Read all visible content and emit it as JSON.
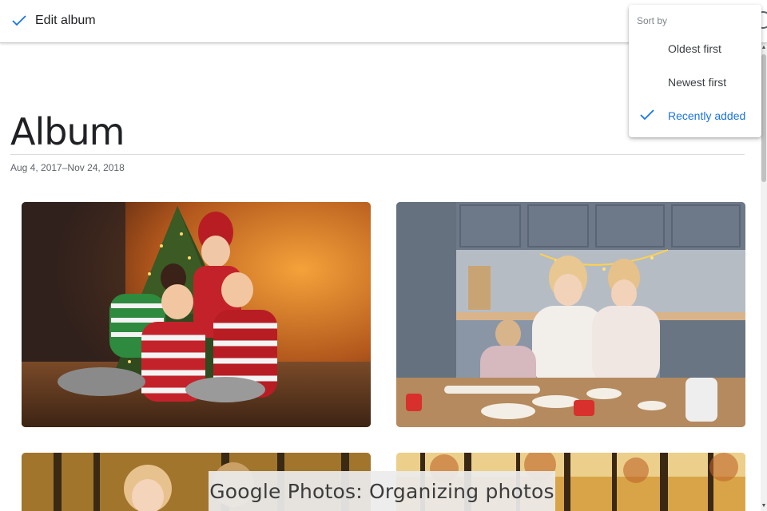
{
  "topbar": {
    "done_icon": "checkmark-icon",
    "title": "Edit album"
  },
  "album": {
    "title": "Album",
    "date_range": "Aug 4, 2017–Nov 24, 2018"
  },
  "sort_menu": {
    "header": "Sort by",
    "options": [
      {
        "label": "Oldest first",
        "selected": false
      },
      {
        "label": "Newest first",
        "selected": false
      },
      {
        "label": "Recently added",
        "selected": true
      }
    ]
  },
  "photos": [
    {
      "subject": "Family in striped pajamas in front of Christmas tree"
    },
    {
      "subject": "Mother and two daughters baking cookies in kitchen"
    },
    {
      "subject": "Two children in autumn park"
    },
    {
      "subject": "Autumn forest"
    }
  ],
  "caption": "Google Photos: Organizing photos",
  "colors": {
    "accent": "#1a73e8",
    "text": "#202124",
    "secondary_text": "#5f6368"
  }
}
